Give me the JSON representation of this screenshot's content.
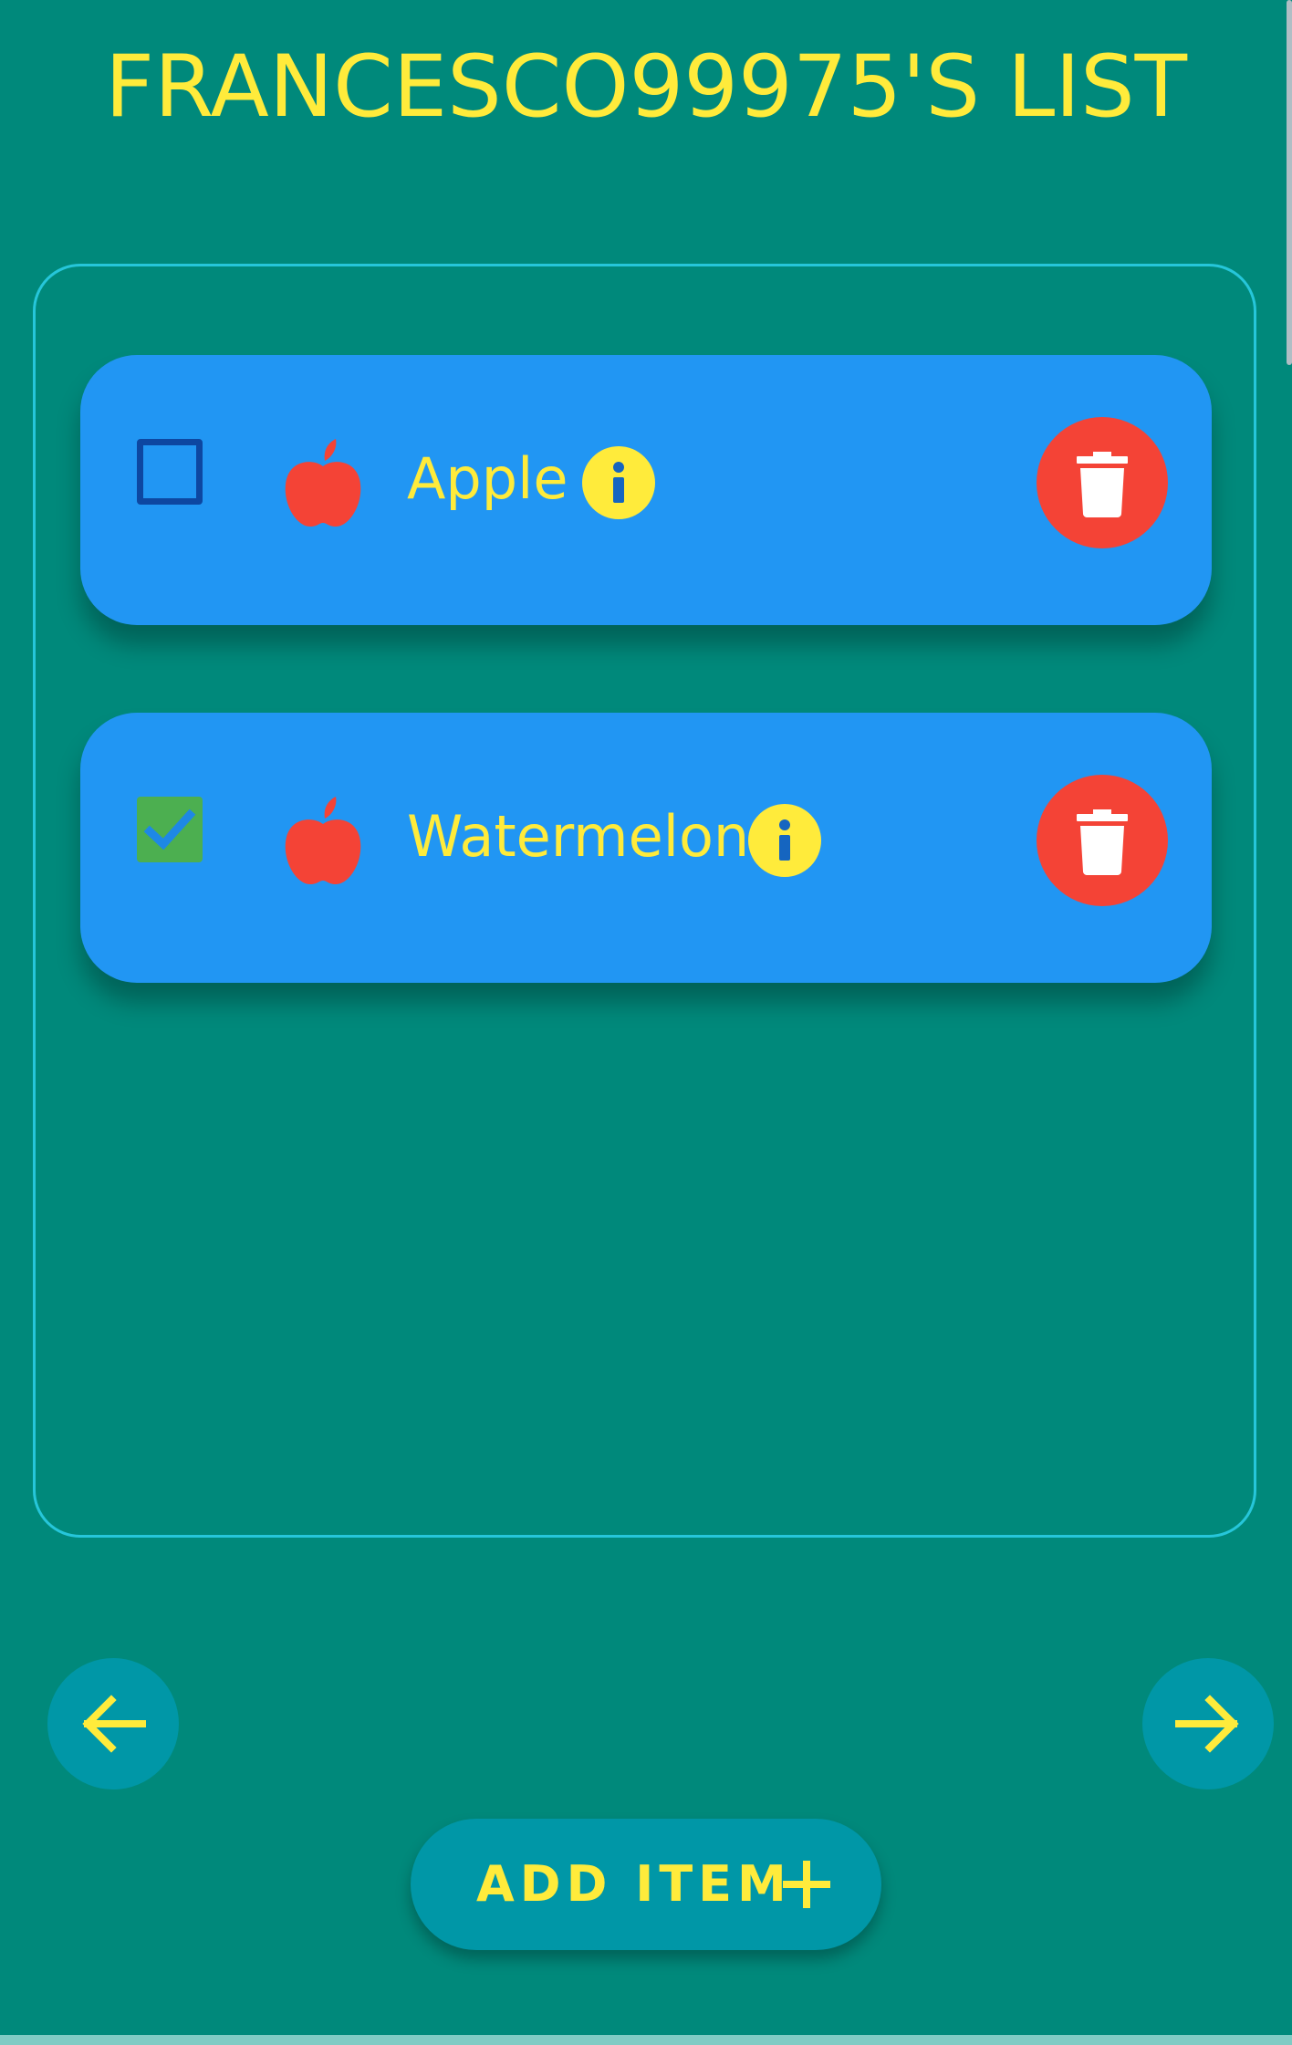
{
  "header": {
    "title": "FRANCESCO99975'S LIST"
  },
  "list": {
    "items": [
      {
        "label": "Apple",
        "checked": false,
        "icon": "apple-icon"
      },
      {
        "label": "Watermelon",
        "checked": true,
        "icon": "apple-icon"
      }
    ]
  },
  "navigation": {
    "prev_icon": "arrow-left-icon",
    "next_icon": "arrow-right-icon"
  },
  "actions": {
    "add_label": "ADD ITEM",
    "add_icon": "plus-icon"
  },
  "colors": {
    "background": "#00897B",
    "accent_text": "#FFEB3B",
    "card": "#2196F3",
    "frame_border": "#26C6DA",
    "delete": "#F44336",
    "checked": "#4CAF50",
    "button": "#0097A7"
  }
}
